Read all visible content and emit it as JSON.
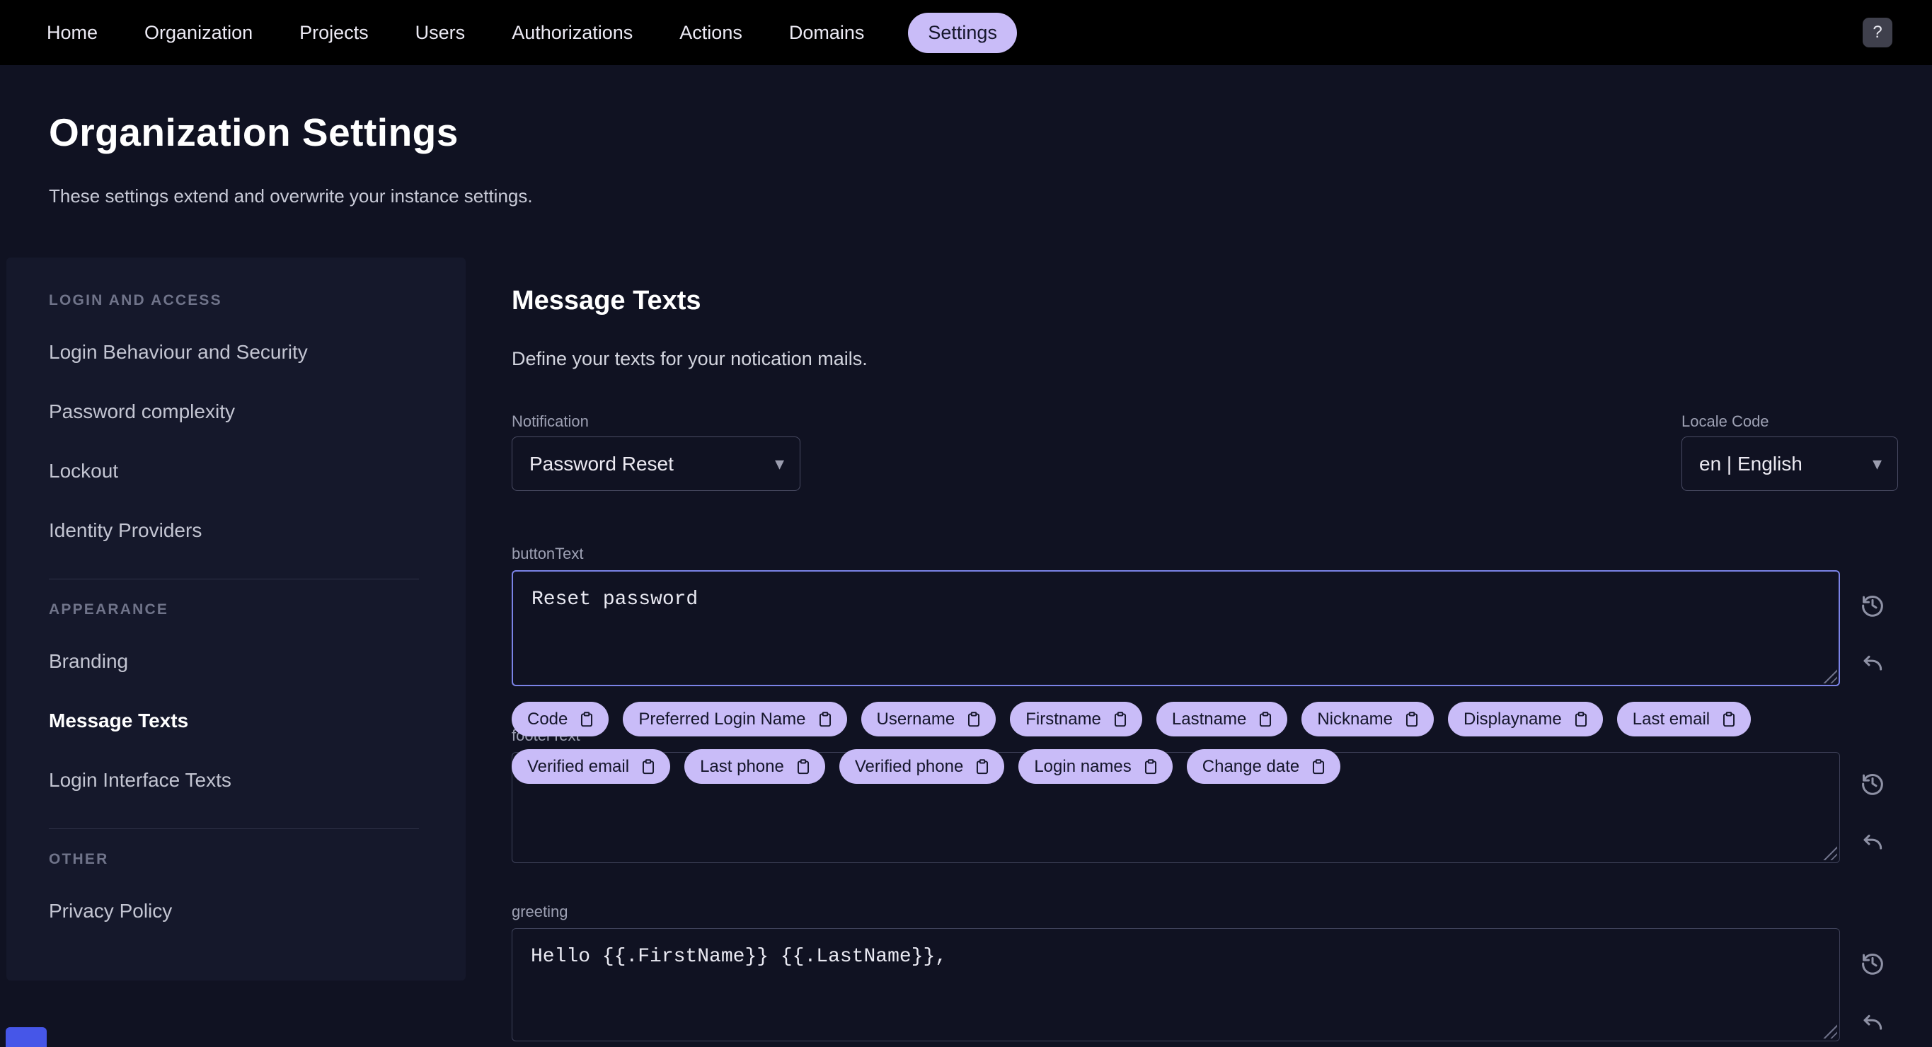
{
  "nav": {
    "items": [
      "Home",
      "Organization",
      "Projects",
      "Users",
      "Authorizations",
      "Actions",
      "Domains",
      "Settings"
    ],
    "active": "Settings",
    "help_label": "?"
  },
  "page": {
    "title": "Organization Settings",
    "subtitle": "These settings extend and overwrite your instance settings."
  },
  "sidebar": {
    "sections": [
      {
        "heading": "LOGIN AND ACCESS",
        "items": [
          "Login Behaviour and Security",
          "Password complexity",
          "Lockout",
          "Identity Providers"
        ]
      },
      {
        "heading": "APPEARANCE",
        "items": [
          "Branding",
          "Message Texts",
          "Login Interface Texts"
        ]
      },
      {
        "heading": "OTHER",
        "items": [
          "Privacy Policy"
        ]
      }
    ],
    "active_item": "Message Texts"
  },
  "main": {
    "heading": "Message Texts",
    "description": "Define your texts for your notication mails.",
    "notification_label": "Notification",
    "notification_value": "Password Reset",
    "locale_label": "Locale Code",
    "locale_value": "en | English",
    "fields": {
      "button_text": {
        "label": "buttonText",
        "value": "Reset password"
      },
      "footer_text": {
        "label": "footerText",
        "value": ""
      },
      "greeting": {
        "label": "greeting",
        "value": "Hello {{.FirstName}} {{.LastName}},"
      }
    },
    "chips_row1": [
      "Code",
      "Preferred Login Name",
      "Username",
      "Firstname",
      "Lastname",
      "Nickname",
      "Displayname",
      "Last email"
    ],
    "chips_row2": [
      "Verified email",
      "Last phone",
      "Verified phone",
      "Login names",
      "Change date"
    ]
  },
  "colors": {
    "nav_bg": "#000000",
    "page_bg": "#101222",
    "accent_chip": "#c9bcf8",
    "focus_border": "#7b83e6",
    "corner_accent": "#4656e8"
  }
}
